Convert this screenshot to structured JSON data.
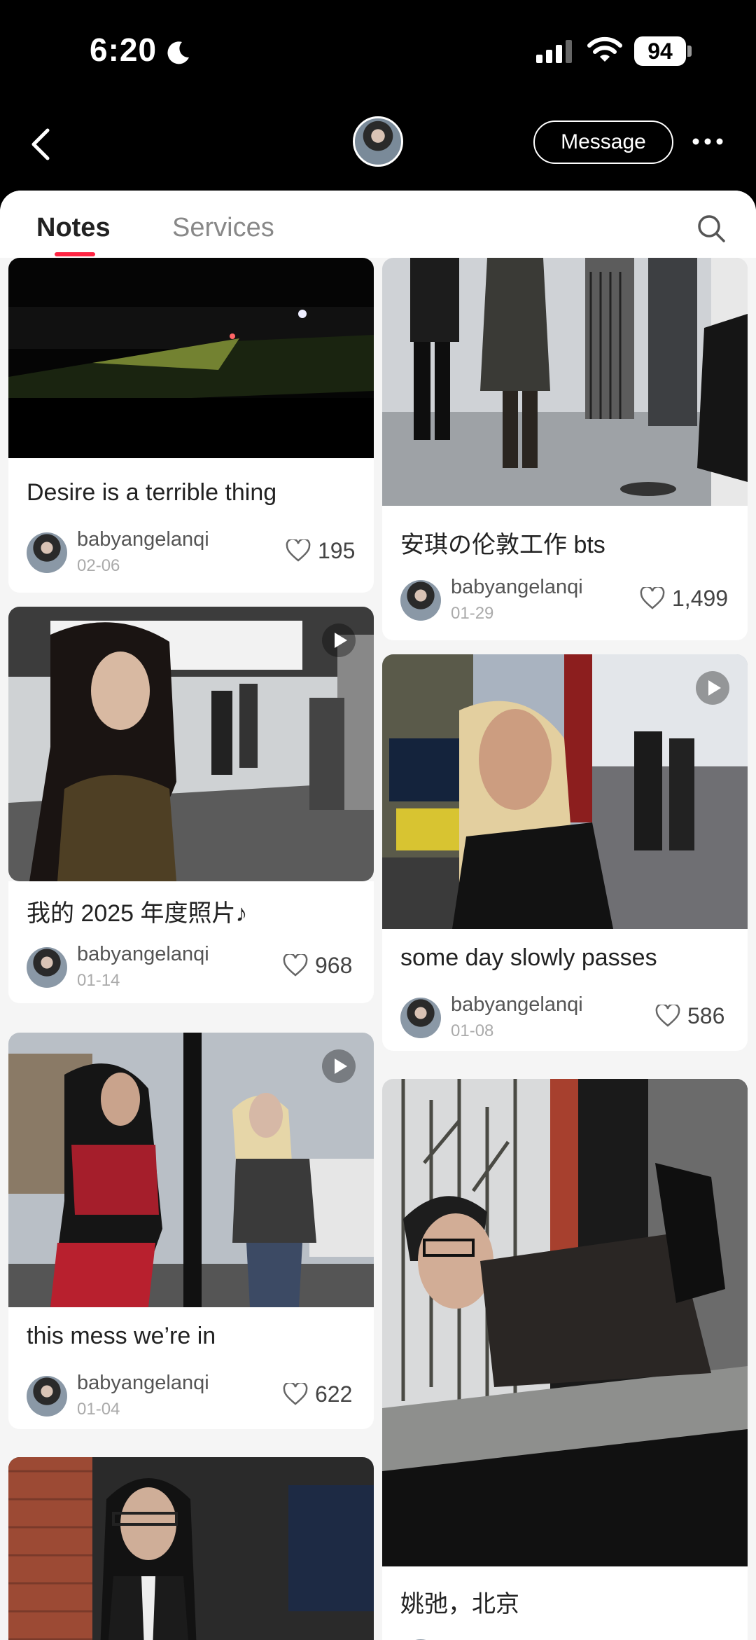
{
  "status_bar": {
    "time": "6:20",
    "battery": "94",
    "icons": [
      "moon-icon",
      "signal-icon",
      "wifi-icon",
      "battery-icon"
    ]
  },
  "nav": {
    "back_icon": "chevron-left-icon",
    "message_label": "Message",
    "more_icon": "more-dots-icon"
  },
  "tabs": {
    "items": [
      {
        "label": "Notes",
        "active": true
      },
      {
        "label": "Services",
        "active": false
      }
    ],
    "search_icon": "search-icon"
  },
  "colors": {
    "accent": "#ff2442",
    "background": "#000000",
    "panel": "#f5f5f5"
  },
  "notes": [
    {
      "title": "Desire is a terrible thing",
      "author": "babyangelanqi",
      "date": "02-06",
      "likes": "195",
      "video": false
    },
    {
      "title": "安琪の伦敦工作 bts",
      "author": "babyangelanqi",
      "date": "01-29",
      "likes": "1,499",
      "video": false
    },
    {
      "title": "我的 2025 年度照片♪",
      "author": "babyangelanqi",
      "date": "01-14",
      "likes": "968",
      "video": true
    },
    {
      "title": "some day slowly passes",
      "author": "babyangelanqi",
      "date": "01-08",
      "likes": "586",
      "video": true
    },
    {
      "title": "this mess we’re in",
      "author": "babyangelanqi",
      "date": "01-04",
      "likes": "622",
      "video": true
    },
    {
      "title": "姚弛，北京",
      "author": "",
      "date": "",
      "likes": "",
      "video": false
    },
    {
      "title": "",
      "author": "",
      "date": "",
      "likes": "",
      "video": false
    }
  ]
}
